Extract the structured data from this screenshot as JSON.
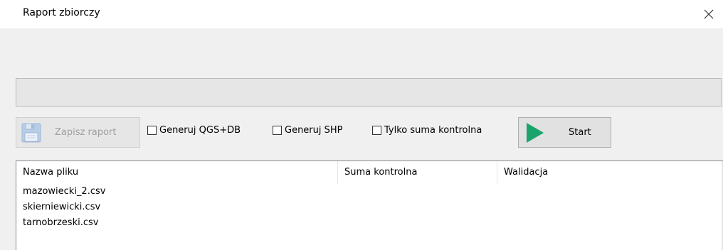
{
  "window": {
    "title": "Raport zbiorczy",
    "close_icon": "close-icon"
  },
  "progress": {
    "value": 0
  },
  "toolbar": {
    "save_label": "Zapisz raport",
    "save_icon": "floppy-disk-icon",
    "save_enabled": false,
    "checkboxes": [
      {
        "label": "Generuj QGS+DB",
        "checked": false
      },
      {
        "label": "Generuj SHP",
        "checked": false
      },
      {
        "label": "Tylko suma kontrolna",
        "checked": false
      }
    ],
    "start_label": "Start",
    "start_icon": "play-icon"
  },
  "file_list": {
    "columns": [
      "Nazwa pliku",
      "Suma kontrolna",
      "Walidacja"
    ],
    "rows": [
      {
        "name": "mazowiecki_2.csv",
        "checksum": "",
        "validation": ""
      },
      {
        "name": "skierniewicki.csv",
        "checksum": "",
        "validation": ""
      },
      {
        "name": "tarnobrzeski.csv",
        "checksum": "",
        "validation": ""
      }
    ]
  },
  "colors": {
    "play_green": "#1aa36b",
    "window_bg": "#f0f0f0"
  }
}
